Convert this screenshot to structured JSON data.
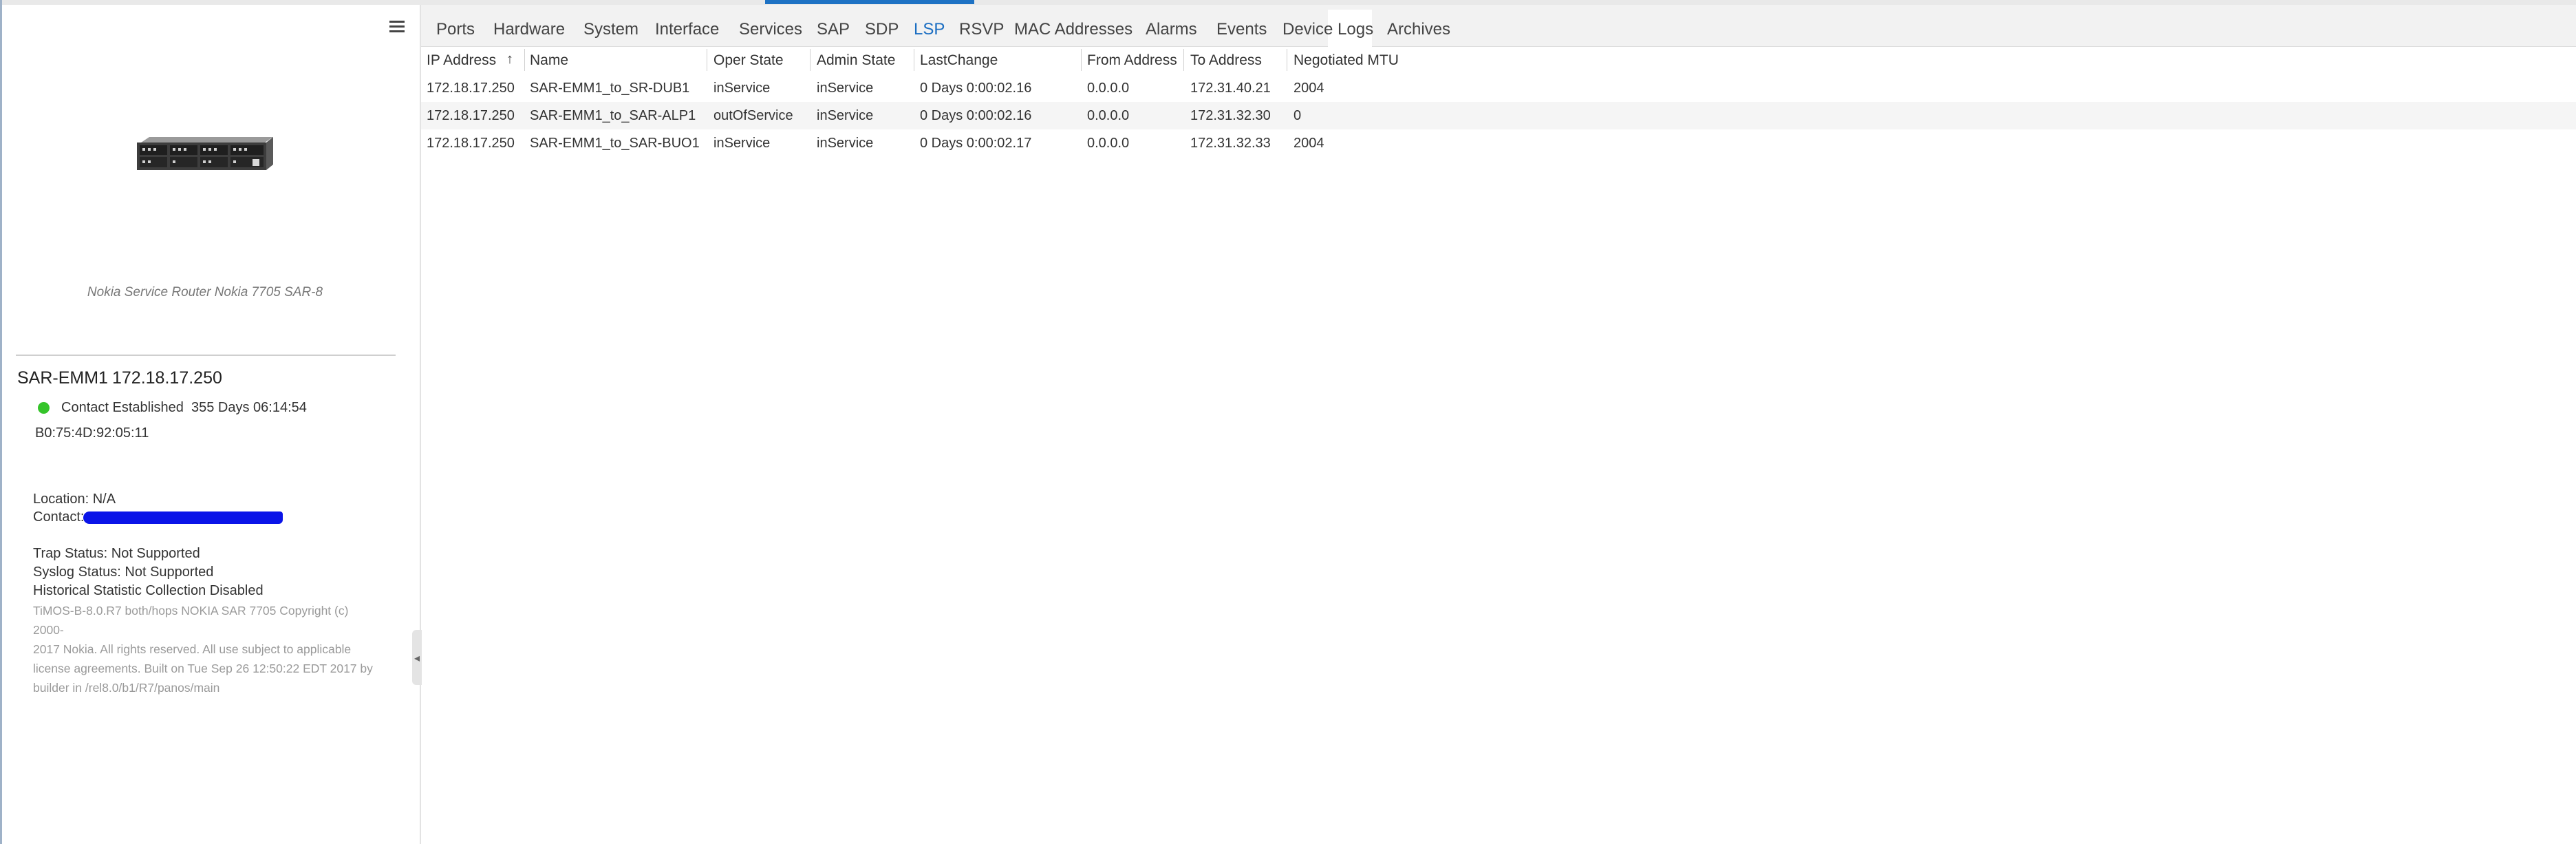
{
  "tabs": [
    "Ports",
    "Hardware",
    "System",
    "Interface",
    "Services",
    "SAP",
    "SDP",
    "LSP",
    "RSVP",
    "MAC Addresses",
    "Alarms",
    "Events",
    "Device Logs",
    "Archives"
  ],
  "active_tab": "LSP",
  "device": {
    "caption": "Nokia Service Router Nokia 7705 SAR-8",
    "name": "SAR-EMM1",
    "ip": "172.18.17.250",
    "contact_status": "Contact Established",
    "uptime": "355 Days 06:14:54",
    "mac": "B0:75:4D:92:05:11",
    "location": "Location: N/A",
    "contact_label": "Contact:",
    "trap_status": "Trap Status: Not Supported",
    "syslog_status": "Syslog Status: Not Supported",
    "historical": "Historical Statistic Collection Disabled",
    "version_lines": [
      "TiMOS-B-8.0.R7 both/hops NOKIA SAR 7705 Copyright (c) 2000-",
      "2017 Nokia. All rights reserved. All use subject to applicable",
      "license agreements. Built on Tue Sep 26 12:50:22 EDT 2017 by",
      "builder in /rel8.0/b1/R7/panos/main"
    ]
  },
  "table": {
    "headers": [
      "IP Address",
      "Name",
      "Oper State",
      "Admin State",
      "LastChange",
      "From Address",
      "To Address",
      "Negotiated MTU"
    ],
    "sort_indicator": "↑",
    "rows": [
      [
        "172.18.17.250",
        "SAR-EMM1_to_SR-DUB1",
        "inService",
        "inService",
        "0 Days 0:00:02.16",
        "0.0.0.0",
        "172.31.40.21",
        "2004"
      ],
      [
        "172.18.17.250",
        "SAR-EMM1_to_SAR-ALP1",
        "outOfService",
        "inService",
        "0 Days 0:00:02.16",
        "0.0.0.0",
        "172.31.32.30",
        "0"
      ],
      [
        "172.18.17.250",
        "SAR-EMM1_to_SAR-BUO1",
        "inService",
        "inService",
        "0 Days 0:00:02.17",
        "0.0.0.0",
        "172.31.32.33",
        "2004"
      ]
    ]
  },
  "colors": {
    "accent": "#1b6ec2",
    "status_ok": "#35c42a",
    "redaction": "#0a14e8"
  }
}
